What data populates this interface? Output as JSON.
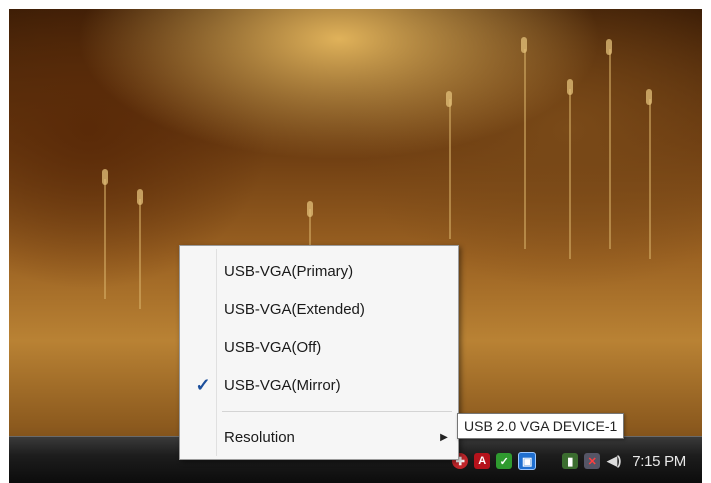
{
  "menu": {
    "items": [
      {
        "label": "USB-VGA(Primary)",
        "checked": false
      },
      {
        "label": "USB-VGA(Extended)",
        "checked": false
      },
      {
        "label": "USB-VGA(Off)",
        "checked": false
      },
      {
        "label": "USB-VGA(Mirror)",
        "checked": true
      },
      {
        "label": "Resolution",
        "has_submenu": true
      }
    ],
    "check_glyph": "✓",
    "submenu_arrow": "▶"
  },
  "tooltip": {
    "text": "USB 2.0 VGA DEVICE-1"
  },
  "taskbar": {
    "clock": "7:15 PM",
    "tray_icons": [
      "shield-icon",
      "adobe-icon",
      "antivirus-icon",
      "usb-vga-icon",
      "battery-icon",
      "network-icon",
      "volume-icon"
    ],
    "colors": {
      "taskbar": "#111111",
      "accent": "#1c4f9c"
    }
  }
}
